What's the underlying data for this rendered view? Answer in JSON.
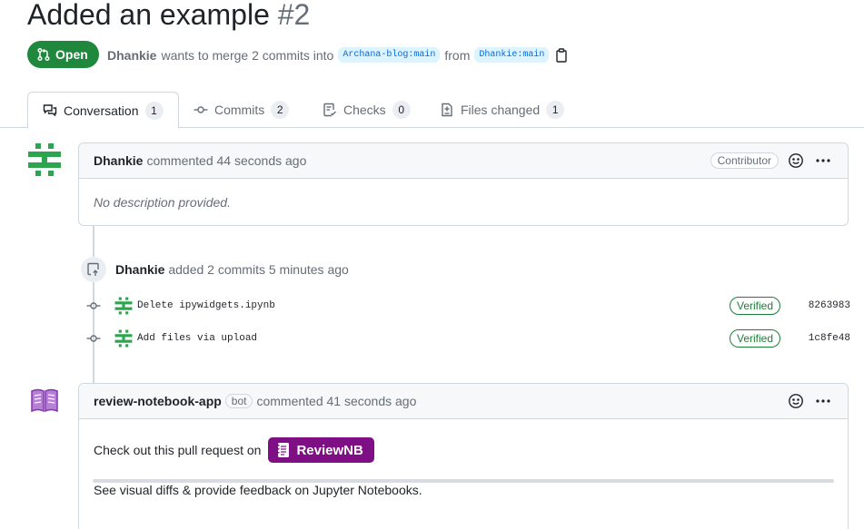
{
  "pr": {
    "title": "Added an example",
    "number": "#2",
    "state": "Open",
    "author": "Dhankie",
    "merge_text": "wants to merge 2 commits into",
    "base_branch": "Archana-blog:main",
    "from_text": "from",
    "head_branch": "Dhankie:main"
  },
  "tabs": [
    {
      "label": "Conversation",
      "count": "1",
      "icon": "comment-discussion-icon"
    },
    {
      "label": "Commits",
      "count": "2",
      "icon": "git-commit-icon"
    },
    {
      "label": "Checks",
      "count": "0",
      "icon": "checklist-icon"
    },
    {
      "label": "Files changed",
      "count": "1",
      "icon": "file-diff-icon"
    }
  ],
  "first_comment": {
    "author": "Dhankie",
    "meta": "commented 44 seconds ago",
    "role": "Contributor",
    "body": "No description provided."
  },
  "commits_event": {
    "author": "Dhankie",
    "text": "added 2 commits 5 minutes ago",
    "commits": [
      {
        "message": "Delete ipywidgets.ipynb",
        "verified": "Verified",
        "sha": "8263983"
      },
      {
        "message": "Add files via upload",
        "verified": "Verified",
        "sha": "1c8fe48"
      }
    ]
  },
  "bot_comment": {
    "author": "review-notebook-app",
    "bot_label": "bot",
    "meta": "commented 41 seconds ago",
    "line1": "Check out this pull request on",
    "button_label": "ReviewNB",
    "line2": "See visual diffs & provide feedback on Jupyter Notebooks."
  },
  "colors": {
    "open_green": "#1f883d",
    "verified_green": "#1a7f37",
    "avatar_green": "#2da44e",
    "reviewnb_purple": "#7f0f85"
  }
}
